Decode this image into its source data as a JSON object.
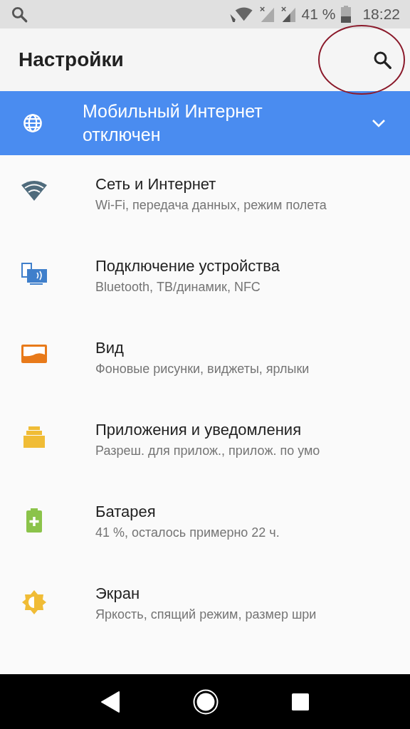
{
  "status_bar": {
    "battery": "41 %",
    "time": "18:22"
  },
  "toolbar": {
    "title": "Настройки"
  },
  "banner": {
    "text": "Мобильный Интернет отключен"
  },
  "items": [
    {
      "kind": "wifi",
      "title": "Сеть и Интернет",
      "subtitle": "Wi-Fi, передача данных, режим полета"
    },
    {
      "kind": "devices",
      "title": "Подключение устройства",
      "subtitle": "Bluetooth, ТВ/динамик, NFC"
    },
    {
      "kind": "display",
      "title": "Вид",
      "subtitle": "Фоновые рисунки, виджеты, ярлыки"
    },
    {
      "kind": "apps",
      "title": "Приложения и уведомления",
      "subtitle": "Разреш. для прилож., прилож. по умо"
    },
    {
      "kind": "battery",
      "title": "Батарея",
      "subtitle": "41 %, осталось примерно 22 ч."
    },
    {
      "kind": "brightness",
      "title": "Экран",
      "subtitle": "Яркость, спящий режим, размер шри"
    }
  ]
}
